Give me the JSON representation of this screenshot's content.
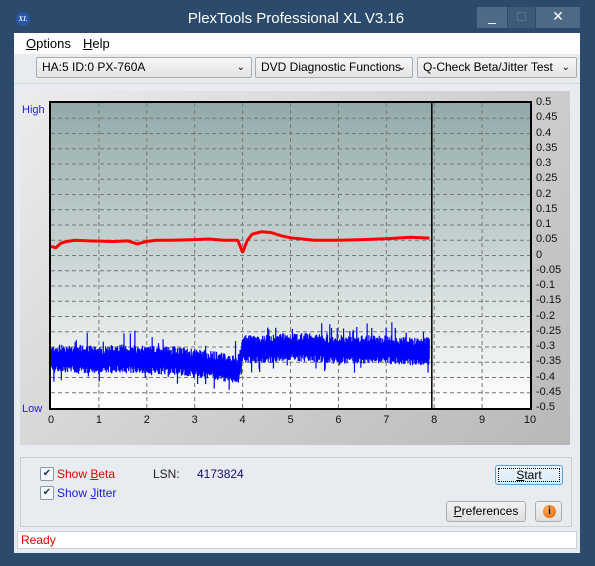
{
  "window": {
    "title": "PlexTools Professional XL V3.16",
    "icon_label": "XL",
    "controls": {
      "minimize": "_",
      "maximize": "□",
      "close": "✕"
    }
  },
  "menu": {
    "items": [
      {
        "label": "Options",
        "accel": "O",
        "rest": "ptions"
      },
      {
        "label": "Help",
        "accel": "H",
        "rest": "elp"
      }
    ]
  },
  "toolbar": {
    "drive_select": "HA:5 ID:0  PX-760A",
    "function_select": "DVD Diagnostic Functions",
    "test_select": "Q-Check Beta/Jitter Test",
    "chevron": "⌄"
  },
  "graph": {
    "high_label": "High",
    "low_label": "Low"
  },
  "chart_data": {
    "type": "line",
    "title": "",
    "xlabel": "",
    "ylabel": "",
    "x_ticks": [
      "0",
      "1",
      "2",
      "3",
      "4",
      "5",
      "6",
      "7",
      "8",
      "9",
      "10"
    ],
    "y_ticks": [
      "0.5",
      "0.45",
      "0.4",
      "0.35",
      "0.3",
      "0.25",
      "0.2",
      "0.15",
      "0.1",
      "0.05",
      "0",
      "-0.05",
      "-0.1",
      "-0.15",
      "-0.2",
      "-0.25",
      "-0.3",
      "-0.35",
      "-0.4",
      "-0.45",
      "-0.5"
    ],
    "xlim": [
      0,
      10
    ],
    "ylim": [
      -0.5,
      0.5
    ],
    "grid": true,
    "progress_marker_x": 7.95,
    "series": [
      {
        "name": "Beta",
        "color": "#ff0000",
        "x": [
          0,
          0.1,
          0.2,
          0.3,
          0.5,
          0.8,
          1.0,
          1.3,
          1.6,
          1.8,
          2.0,
          2.2,
          2.5,
          3.0,
          3.3,
          3.6,
          3.9,
          3.95,
          4.0,
          4.1,
          4.2,
          4.4,
          4.6,
          4.8,
          5.0,
          5.5,
          6.0,
          6.5,
          7.0,
          7.5,
          7.9
        ],
        "values": [
          0.03,
          0.025,
          0.04,
          0.045,
          0.05,
          0.048,
          0.047,
          0.046,
          0.048,
          0.038,
          0.046,
          0.05,
          0.05,
          0.052,
          0.054,
          0.05,
          0.05,
          0.03,
          0.01,
          0.05,
          0.07,
          0.078,
          0.075,
          0.065,
          0.058,
          0.05,
          0.05,
          0.052,
          0.055,
          0.06,
          0.057
        ]
      },
      {
        "name": "Jitter",
        "color": "#0000ff",
        "x": [
          0,
          0.5,
          1.0,
          1.5,
          2.0,
          2.5,
          3.0,
          3.5,
          3.9,
          4.0,
          4.5,
          5.0,
          5.5,
          6.0,
          6.5,
          7.0,
          7.5,
          7.9
        ],
        "values": [
          -0.34,
          -0.34,
          -0.345,
          -0.34,
          -0.345,
          -0.345,
          -0.355,
          -0.365,
          -0.38,
          -0.31,
          -0.31,
          -0.3,
          -0.305,
          -0.31,
          -0.31,
          -0.31,
          -0.315,
          -0.315
        ],
        "band": 0.035
      }
    ]
  },
  "controls": {
    "show_beta": {
      "label": "Show Beta",
      "pre": "Show ",
      "accel": "B",
      "rest": "eta",
      "checked": true,
      "color": "#e00000"
    },
    "show_jitter": {
      "label": "Show Jitter",
      "pre": "Show ",
      "accel": "J",
      "rest": "itter",
      "checked": true,
      "color": "#1a1adc"
    },
    "lsn_label": "LSN:",
    "lsn_value": "4173824",
    "start_button": {
      "label": "Start",
      "accel": "S",
      "rest": "tart"
    },
    "preferences_button": {
      "label": "Preferences",
      "accel": "P",
      "rest": "references"
    },
    "info_button": "i",
    "check_glyph": "✔"
  },
  "status": {
    "text": "Ready"
  }
}
